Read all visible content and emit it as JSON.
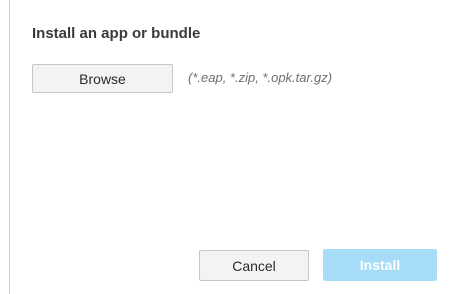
{
  "dialog": {
    "title": "Install an app or bundle",
    "browse_label": "Browse",
    "file_types_hint": "(*.eap, *.zip, *.opk.tar.gz)",
    "cancel_label": "Cancel",
    "install_label": "Install",
    "install_state": "disabled"
  },
  "colors": {
    "install_disabled_bg": "#a6dcf7",
    "button_bg": "#f3f3f3",
    "title_text": "#3a3a3a",
    "hint_text": "#6e6e6e"
  }
}
